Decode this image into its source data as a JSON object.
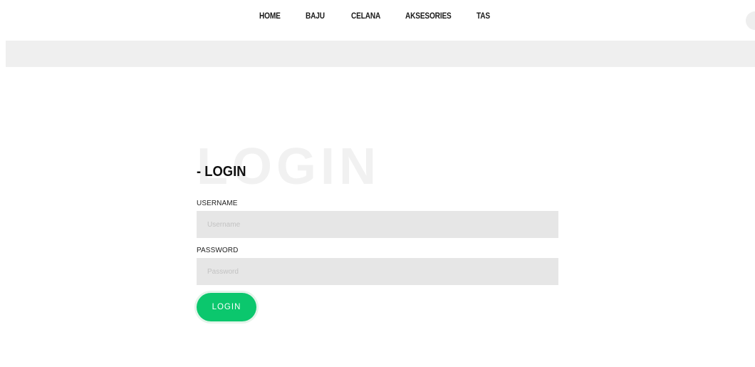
{
  "nav": {
    "items": [
      {
        "label": "HOME"
      },
      {
        "label": "BAJU"
      },
      {
        "label": "CELANA"
      },
      {
        "label": "AKSESORIES"
      },
      {
        "label": "TAS"
      }
    ]
  },
  "login": {
    "watermark": "LOGIN",
    "title": "- LOGIN",
    "username_label": "USERNAME",
    "username_placeholder": "Username",
    "username_value": "",
    "password_label": "PASSWORD",
    "password_placeholder": "Password",
    "password_value": "",
    "button_label": "LOGIN"
  },
  "colors": {
    "accent": "#0bc76d",
    "input_bg": "#e6e6e6",
    "banner_bg": "#efefef"
  }
}
